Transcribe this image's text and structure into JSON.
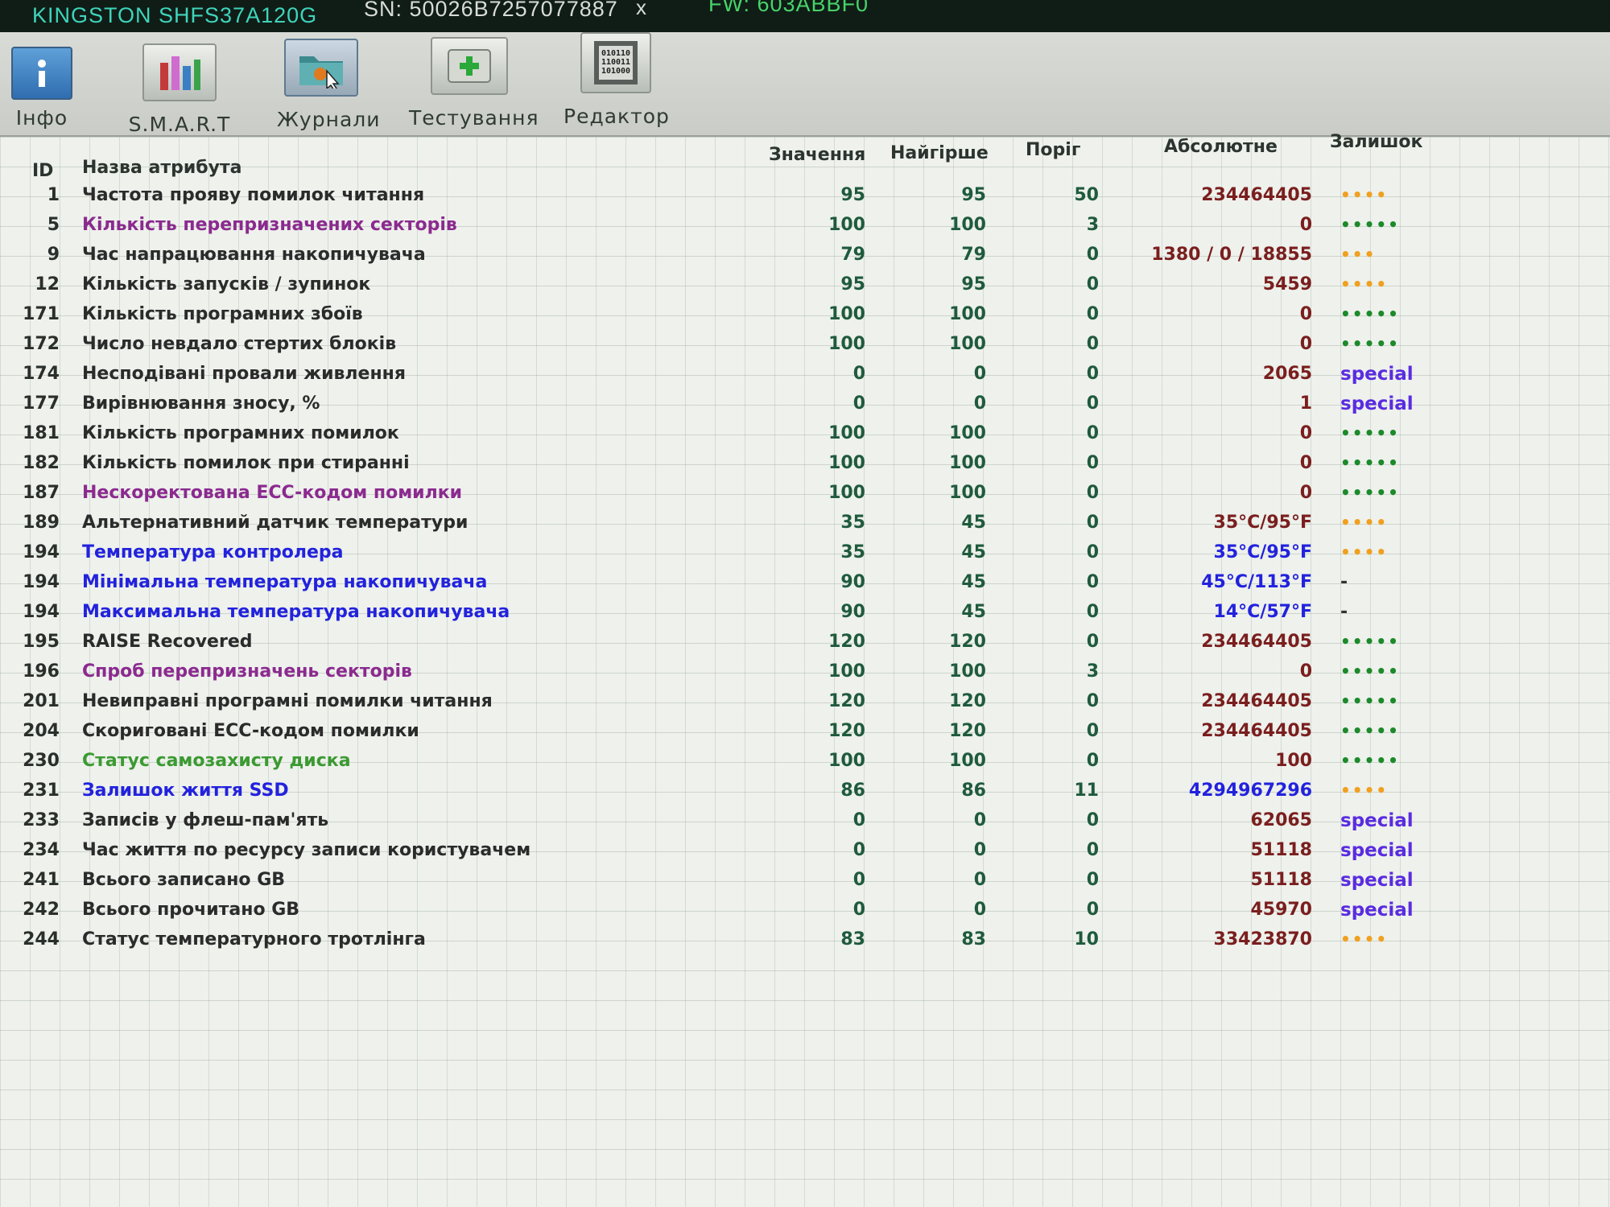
{
  "title_bar": {
    "model": "KINGSTON SHFS37A120G",
    "serial": "SN: 50026B7257077887",
    "close_glyph": "x",
    "firmware": "FW: 603ABBF0"
  },
  "toolbar": {
    "items": [
      {
        "label": "Інфо",
        "icon": "info-icon"
      },
      {
        "label": "S.M.A.R.T",
        "icon": "smart-bars-icon"
      },
      {
        "label": "Журнали",
        "icon": "logs-folder-icon"
      },
      {
        "label": "Тестування",
        "icon": "test-plus-icon"
      },
      {
        "label": "Редактор",
        "icon": "hex-editor-icon"
      }
    ]
  },
  "table": {
    "headers": {
      "id": "ID",
      "name": "Назва атрибута",
      "value": "Значення",
      "worst": "Найгірше",
      "threshold": "Поріг",
      "raw": "Абсолютне",
      "health": "Залишок"
    },
    "rows": [
      {
        "id": "1",
        "name": "Частота прояву помилок читання",
        "value": "95",
        "worst": "95",
        "threshold": "50",
        "raw": "234464405",
        "health": "••••"
      },
      {
        "id": "5",
        "name": "Кількість перепризначених секторів",
        "value": "100",
        "worst": "100",
        "threshold": "3",
        "raw": "0",
        "health": "•••••"
      },
      {
        "id": "9",
        "name": "Час напрацювання накопичувача",
        "value": "79",
        "worst": "79",
        "threshold": "0",
        "raw": "1380 / 0 / 18855",
        "health": "•••"
      },
      {
        "id": "12",
        "name": "Кількість запусків / зупинок",
        "value": "95",
        "worst": "95",
        "threshold": "0",
        "raw": "5459",
        "health": "••••"
      },
      {
        "id": "171",
        "name": "Кількість програмних збоїв",
        "value": "100",
        "worst": "100",
        "threshold": "0",
        "raw": "0",
        "health": "•••••"
      },
      {
        "id": "172",
        "name": "Число невдало стертих блоків",
        "value": "100",
        "worst": "100",
        "threshold": "0",
        "raw": "0",
        "health": "•••••"
      },
      {
        "id": "174",
        "name": "Несподівані провали живлення",
        "value": "0",
        "worst": "0",
        "threshold": "0",
        "raw": "2065",
        "health": "special"
      },
      {
        "id": "177",
        "name": "Вирівнювання зносу, %",
        "value": "0",
        "worst": "0",
        "threshold": "0",
        "raw": "1",
        "health": "special"
      },
      {
        "id": "181",
        "name": "Кількість програмних помилок",
        "value": "100",
        "worst": "100",
        "threshold": "0",
        "raw": "0",
        "health": "•••••"
      },
      {
        "id": "182",
        "name": "Кількість помилок при стиранні",
        "value": "100",
        "worst": "100",
        "threshold": "0",
        "raw": "0",
        "health": "•••••"
      },
      {
        "id": "187",
        "name": "Нескоректована ECC-кодом помилки",
        "value": "100",
        "worst": "100",
        "threshold": "0",
        "raw": "0",
        "health": "•••••"
      },
      {
        "id": "189",
        "name": "Альтернативний датчик температури",
        "value": "35",
        "worst": "45",
        "threshold": "0",
        "raw": "35°C/95°F",
        "health": "••••"
      },
      {
        "id": "194",
        "name": "Температура контролера",
        "value": "35",
        "worst": "45",
        "threshold": "0",
        "raw": "35°C/95°F",
        "health": "••••"
      },
      {
        "id": "194",
        "name": "Мінімальна температура накопичувача",
        "value": "90",
        "worst": "45",
        "threshold": "0",
        "raw": "45°C/113°F",
        "health": "-"
      },
      {
        "id": "194",
        "name": "Максимальна температура накопичувача",
        "value": "90",
        "worst": "45",
        "threshold": "0",
        "raw": "14°C/57°F",
        "health": "-"
      },
      {
        "id": "195",
        "name": "RAISE Recovered",
        "value": "120",
        "worst": "120",
        "threshold": "0",
        "raw": "234464405",
        "health": "•••••"
      },
      {
        "id": "196",
        "name": "Спроб перепризначень секторів",
        "value": "100",
        "worst": "100",
        "threshold": "3",
        "raw": "0",
        "health": "•••••"
      },
      {
        "id": "201",
        "name": "Невиправні програмні помилки читання",
        "value": "120",
        "worst": "120",
        "threshold": "0",
        "raw": "234464405",
        "health": "•••••"
      },
      {
        "id": "204",
        "name": "Скориговані ECC-кодом помилки",
        "value": "120",
        "worst": "120",
        "threshold": "0",
        "raw": "234464405",
        "health": "•••••"
      },
      {
        "id": "230",
        "name": "Статус самозахисту диска",
        "value": "100",
        "worst": "100",
        "threshold": "0",
        "raw": "100",
        "health": "•••••"
      },
      {
        "id": "231",
        "name": "Залишок життя SSD",
        "value": "86",
        "worst": "86",
        "threshold": "11",
        "raw": "4294967296",
        "health": "••••"
      },
      {
        "id": "233",
        "name": "Записів у флеш-пам'ять",
        "value": "0",
        "worst": "0",
        "threshold": "0",
        "raw": "62065",
        "health": "special"
      },
      {
        "id": "234",
        "name": "Час життя по ресурсу записи користувачем",
        "value": "0",
        "worst": "0",
        "threshold": "0",
        "raw": "51118",
        "health": "special"
      },
      {
        "id": "241",
        "name": "Всього записано GB",
        "value": "0",
        "worst": "0",
        "threshold": "0",
        "raw": "51118",
        "health": "special"
      },
      {
        "id": "242",
        "name": "Всього прочитано GB",
        "value": "0",
        "worst": "0",
        "threshold": "0",
        "raw": "45970",
        "health": "special"
      },
      {
        "id": "244",
        "name": "Статус температурного тротлінга",
        "value": "83",
        "worst": "83",
        "threshold": "10",
        "raw": "33423870",
        "health": "••••"
      }
    ]
  }
}
